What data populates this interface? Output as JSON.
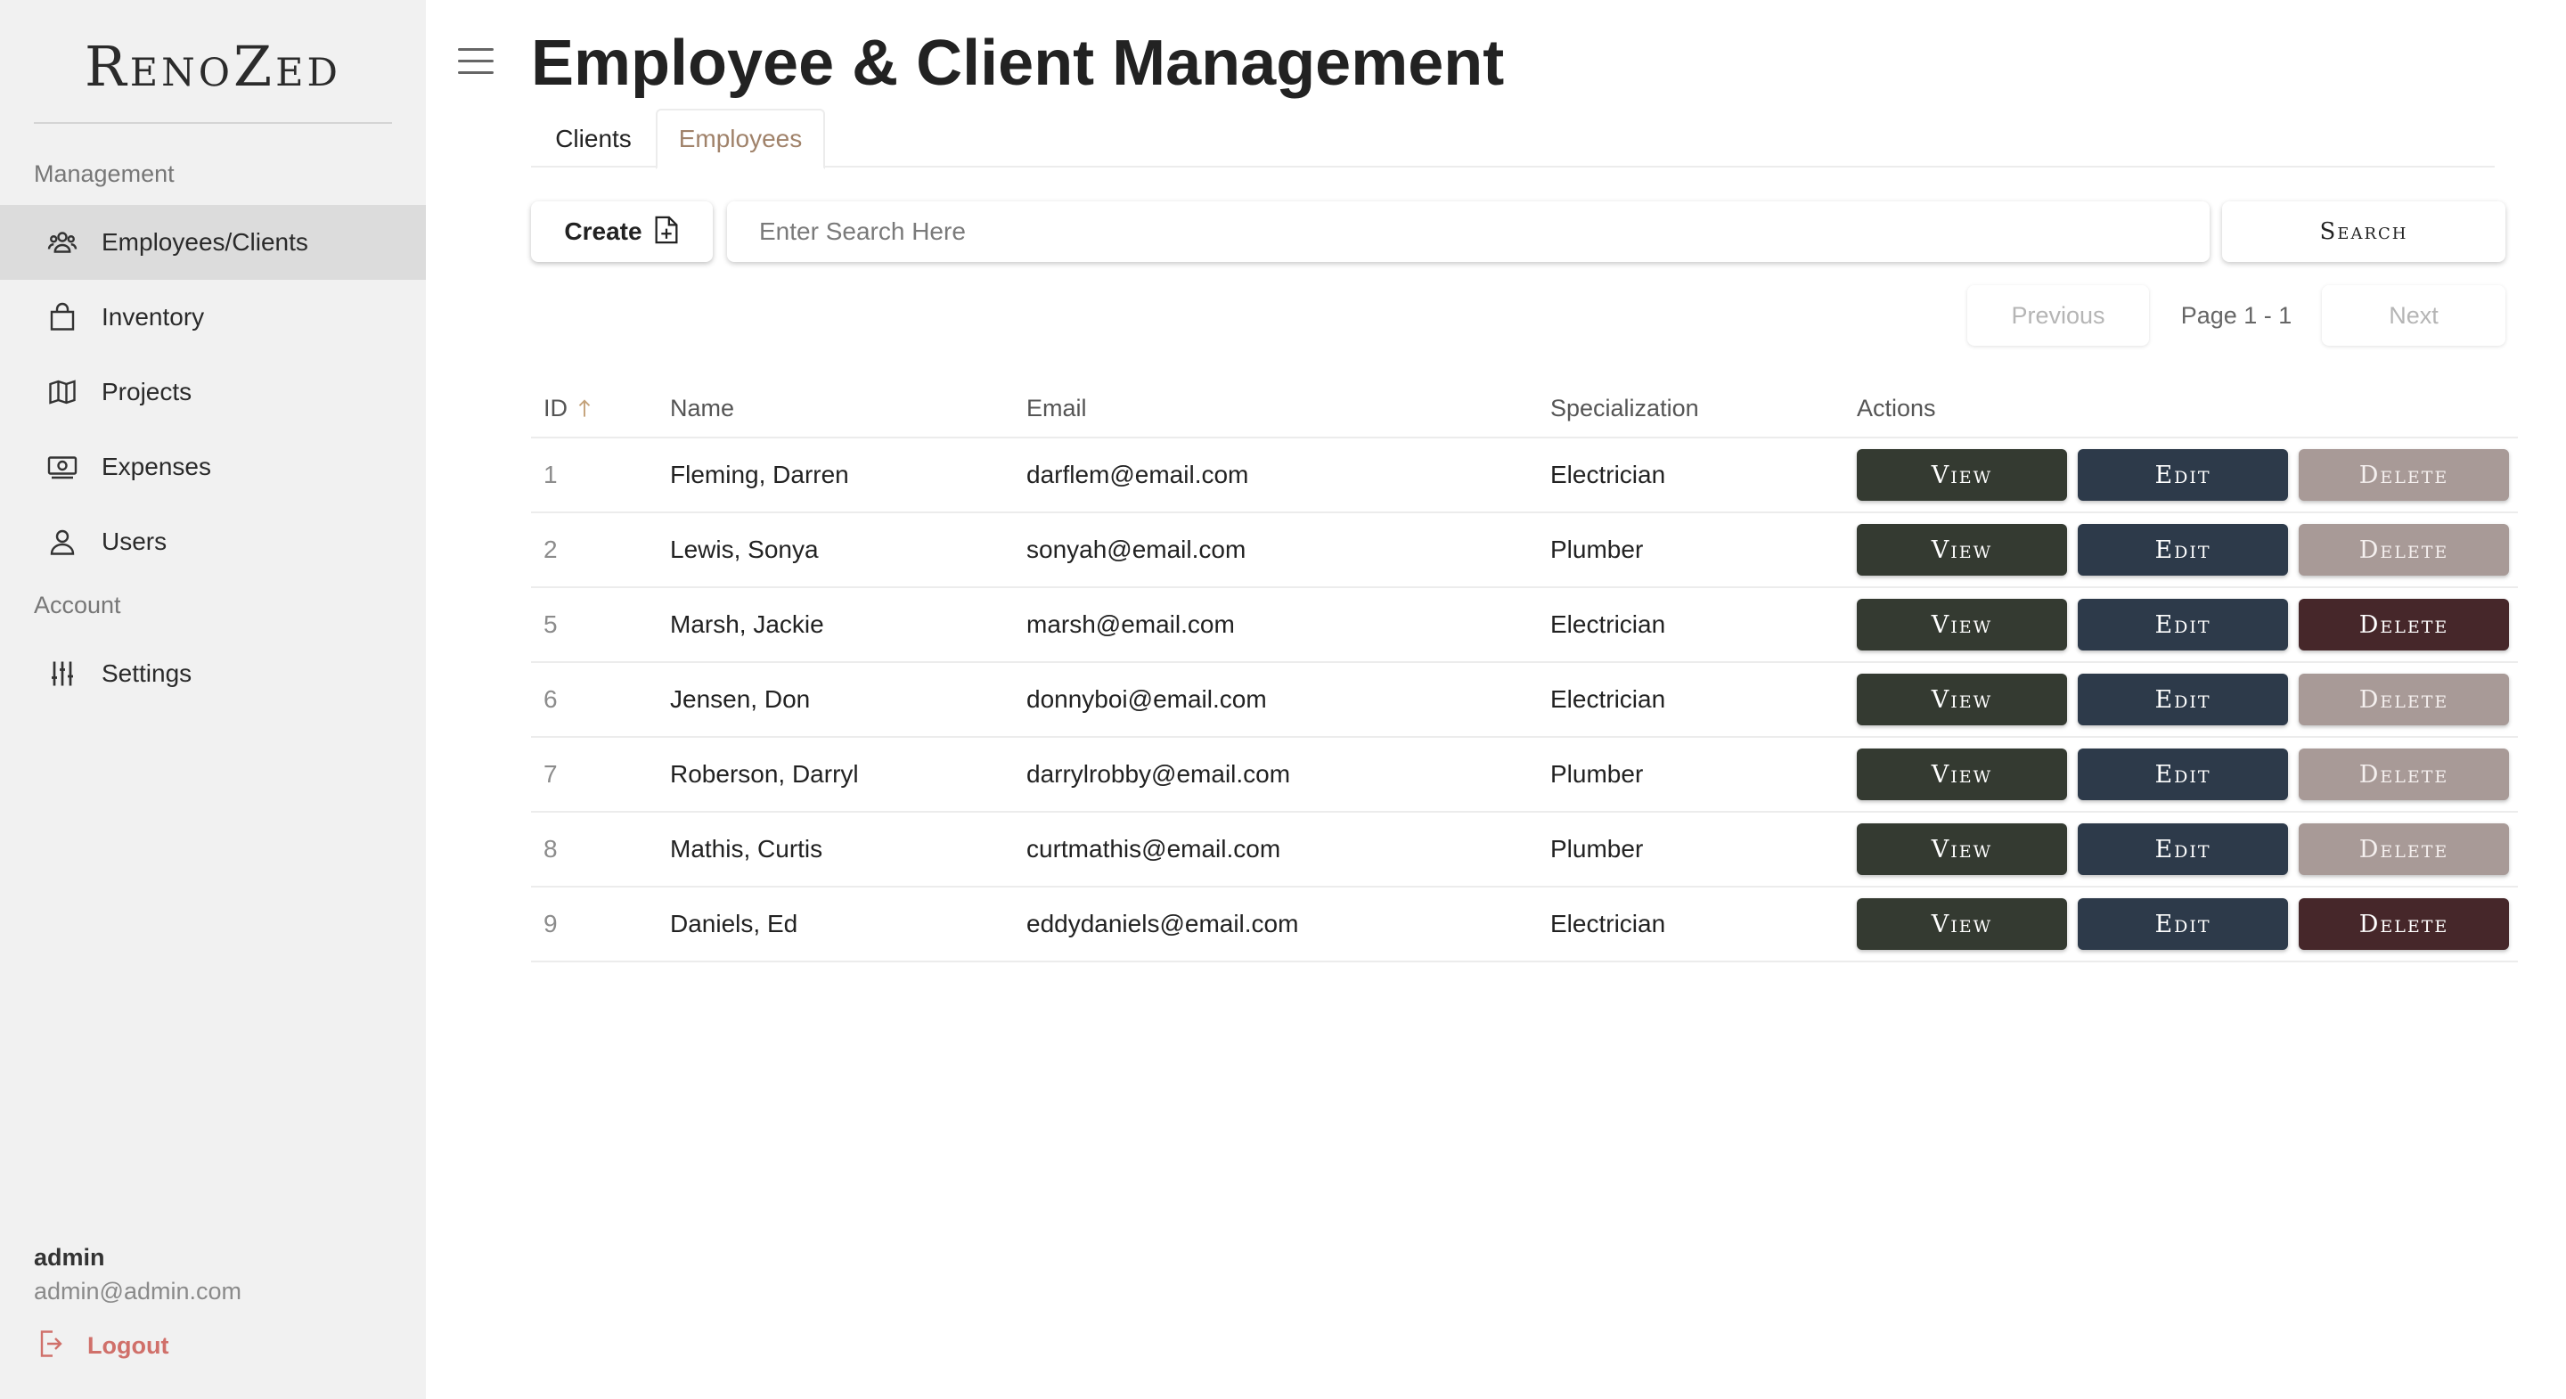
{
  "app": {
    "logo": "RenoZed"
  },
  "sidebar": {
    "management_label": "Management",
    "account_label": "Account",
    "items": [
      {
        "label": "Employees/Clients",
        "icon": "people-icon"
      },
      {
        "label": "Inventory",
        "icon": "shopping-bag-icon"
      },
      {
        "label": "Projects",
        "icon": "map-icon"
      },
      {
        "label": "Expenses",
        "icon": "money-icon"
      },
      {
        "label": "Users",
        "icon": "user-icon"
      }
    ],
    "account_items": [
      {
        "label": "Settings",
        "icon": "sliders-icon"
      }
    ],
    "user": {
      "name": "admin",
      "email": "admin@admin.com"
    },
    "logout_label": "Logout"
  },
  "header": {
    "title": "Employee & Client Management"
  },
  "tabs": [
    {
      "label": "Clients",
      "active": false
    },
    {
      "label": "Employees",
      "active": true
    }
  ],
  "toolbar": {
    "create_label": "Create",
    "search_placeholder": "Enter Search Here",
    "search_label": "Search"
  },
  "pager": {
    "previous": "Previous",
    "page": "Page 1 - 1",
    "next": "Next"
  },
  "table": {
    "columns": [
      "ID",
      "Name",
      "Email",
      "Specialization",
      "Actions"
    ],
    "sort": {
      "column": "ID",
      "direction": "ascending"
    },
    "action_labels": {
      "view": "View",
      "edit": "Edit",
      "delete": "Delete"
    },
    "rows": [
      {
        "id": "1",
        "name": "Fleming, Darren",
        "email": "darflem@email.com",
        "specialization": "Electrician",
        "delete_enabled": false
      },
      {
        "id": "2",
        "name": "Lewis, Sonya",
        "email": "sonyah@email.com",
        "specialization": "Plumber",
        "delete_enabled": false
      },
      {
        "id": "5",
        "name": "Marsh, Jackie",
        "email": "marsh@email.com",
        "specialization": "Electrician",
        "delete_enabled": true
      },
      {
        "id": "6",
        "name": "Jensen, Don",
        "email": "donnyboi@email.com",
        "specialization": "Electrician",
        "delete_enabled": false
      },
      {
        "id": "7",
        "name": "Roberson, Darryl",
        "email": "darrylrobby@email.com",
        "specialization": "Plumber",
        "delete_enabled": false
      },
      {
        "id": "8",
        "name": "Mathis, Curtis",
        "email": "curtmathis@email.com",
        "specialization": "Plumber",
        "delete_enabled": false
      },
      {
        "id": "9",
        "name": "Daniels, Ed",
        "email": "eddydaniels@email.com",
        "specialization": "Electrician",
        "delete_enabled": true
      }
    ]
  },
  "colors": {
    "sidebar_bg": "#f1f1f1",
    "active_nav_bg": "#dcdcdc",
    "active_tab_text": "#a0826a",
    "view_button": "#343a31",
    "edit_button": "#2d3a4a",
    "delete_disabled": "#a89a97",
    "delete_enabled": "#46272a",
    "logout_text": "#d0706a"
  }
}
